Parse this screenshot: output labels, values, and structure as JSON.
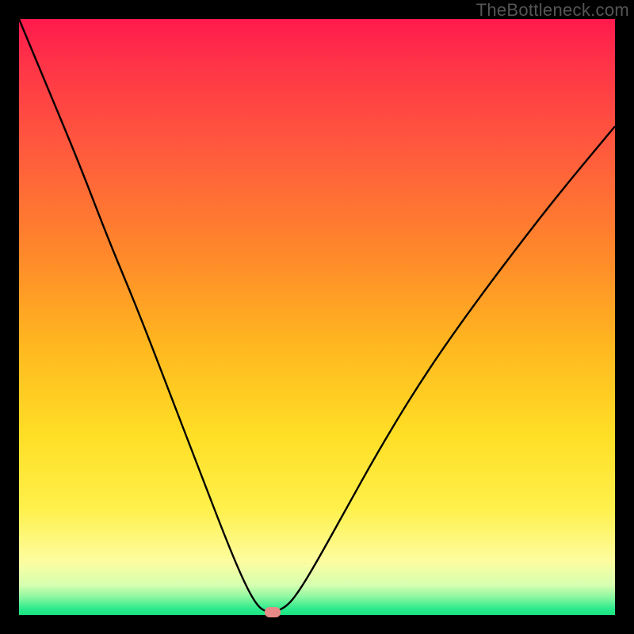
{
  "watermark": "TheBottleneck.com",
  "chart_data": {
    "type": "line",
    "title": "",
    "xlabel": "",
    "ylabel": "",
    "xlim": [
      0,
      100
    ],
    "ylim": [
      0,
      100
    ],
    "series": [
      {
        "name": "curve",
        "x": [
          0,
          5,
          10,
          15,
          20,
          25,
          30,
          35,
          38,
          40,
          41.5,
          43,
          45,
          47,
          50,
          55,
          60,
          66,
          72,
          80,
          90,
          100
        ],
        "y": [
          100,
          88,
          76,
          63,
          51,
          38,
          25,
          12,
          5,
          1.5,
          0.5,
          0.5,
          1.5,
          4,
          9,
          18,
          27,
          37,
          46,
          57,
          70,
          82
        ]
      }
    ],
    "marker": {
      "x": 42.5,
      "y": 0.5
    },
    "colors": {
      "curve": "#000000",
      "marker": "#e68a87",
      "gradient_top": "#ff1a4d",
      "gradient_bottom": "#17e47f"
    }
  }
}
